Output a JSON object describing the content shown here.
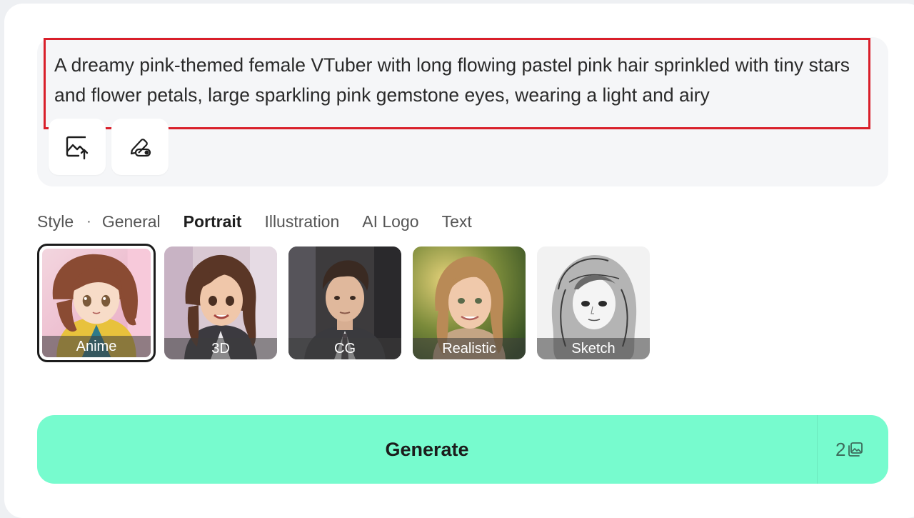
{
  "prompt": {
    "text": "A dreamy pink-themed female VTuber with long flowing pastel pink hair sprinkled with tiny stars and flower petals, large sparkling pink gemstone eyes, wearing a light and airy"
  },
  "tools": {
    "upload_icon": "image-upload-icon",
    "eraser_icon": "eraser-icon"
  },
  "style": {
    "label": "Style",
    "separator": "·",
    "tabs": [
      "General",
      "Portrait",
      "Illustration",
      "AI Logo",
      "Text"
    ],
    "active_tab": "Portrait",
    "presets": [
      {
        "label": "Anime",
        "selected": true
      },
      {
        "label": "3D",
        "selected": false
      },
      {
        "label": "CG",
        "selected": false
      },
      {
        "label": "Realistic",
        "selected": false
      },
      {
        "label": "Sketch",
        "selected": false
      }
    ]
  },
  "generate": {
    "label": "Generate",
    "credit_count": "2",
    "credit_icon": "image-stack-icon",
    "color": "#77fbce"
  },
  "colors": {
    "highlight_outline": "#d91f2a"
  }
}
